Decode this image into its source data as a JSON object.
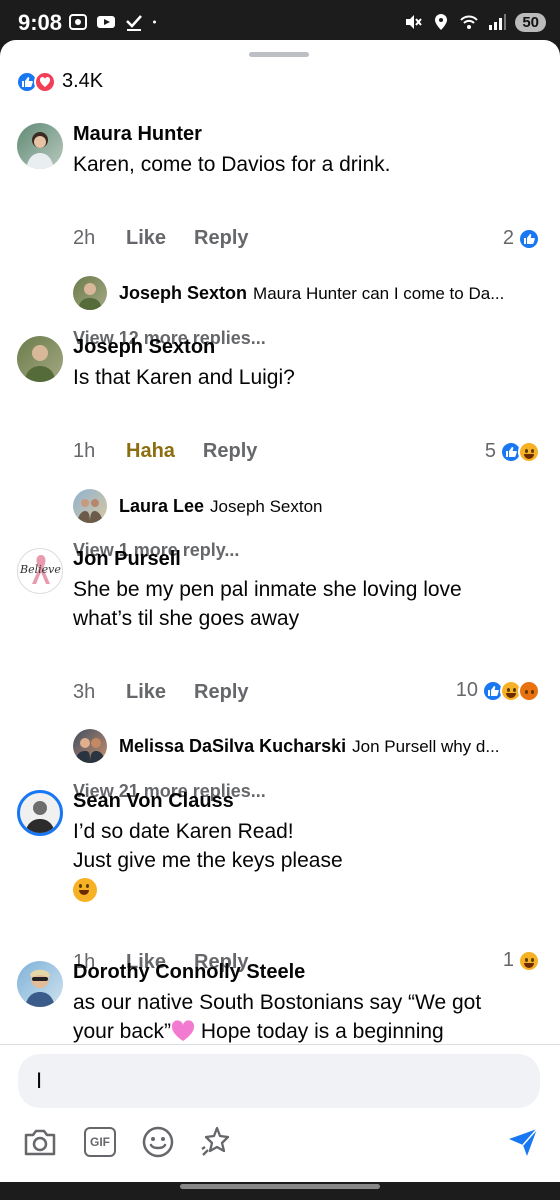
{
  "status": {
    "time": "9:08",
    "battery": "50",
    "left_icons": [
      "screenshot-icon",
      "youtube-icon",
      "checkmark-icon",
      "dot-icon"
    ],
    "right_icons": [
      "mute-icon",
      "location-icon",
      "wifi-icon",
      "signal-icon"
    ]
  },
  "post": {
    "reactions_count": "3.4K",
    "reaction_types": [
      "like",
      "love"
    ]
  },
  "comments": [
    {
      "author": "Maura Hunter",
      "text": "Karen, come to Davios for a drink.",
      "time": "2h",
      "like_label": "Like",
      "reply_label": "Reply",
      "reaction_count": "2",
      "reactions": [
        "like"
      ],
      "reply_preview": {
        "author": "Joseph Sexton",
        "text": "Maura Hunter can I come to Da..."
      },
      "view_more": "View 12 more replies..."
    },
    {
      "author": "Joseph Sexton",
      "text": "Is that Karen and Luigi?",
      "time": "1h",
      "like_label": "Haha",
      "reply_label": "Reply",
      "reaction_count": "5",
      "reactions": [
        "like",
        "haha"
      ],
      "reply_preview": {
        "author": "Laura Lee",
        "text": "Joseph Sexton"
      },
      "view_more": "View 1 more reply..."
    },
    {
      "author": "Jon Pursell",
      "text": "She be my pen pal inmate she loving love what’s til she goes away",
      "time": "3h",
      "like_label": "Like",
      "reply_label": "Reply",
      "reaction_count": "10",
      "reactions": [
        "like",
        "haha",
        "angry"
      ],
      "reply_preview": {
        "author": "Melissa DaSilva Kucharski",
        "text": "Jon Pursell  why d..."
      },
      "view_more": "View 21 more replies...",
      "avatar_text": "Believe"
    },
    {
      "author": "Sean Von Clauss",
      "text_lines": [
        "I’d so date Karen Read!",
        "Just give me the keys please"
      ],
      "time": "1h",
      "like_label": "Like",
      "reply_label": "Reply",
      "reaction_count": "1",
      "reactions": [
        "haha"
      ]
    },
    {
      "author": "Dorothy Connolly Steele",
      "text_lines": [
        "as our native South Bostonians say “We got",
        "your back”",
        "Hope today is a beginning"
      ]
    }
  ],
  "composer": {
    "value": "I",
    "tools": [
      "camera-icon",
      "gif-icon",
      "emoji-icon",
      "sticker-icon",
      "send-icon"
    ],
    "gif_label": "GIF"
  },
  "colors": {
    "like_blue": "#1877f2",
    "love_red": "#f33e58",
    "haha_yellow": "#f7b125",
    "angry_orange": "#e9710f",
    "haha_text": "#8b6e10"
  }
}
